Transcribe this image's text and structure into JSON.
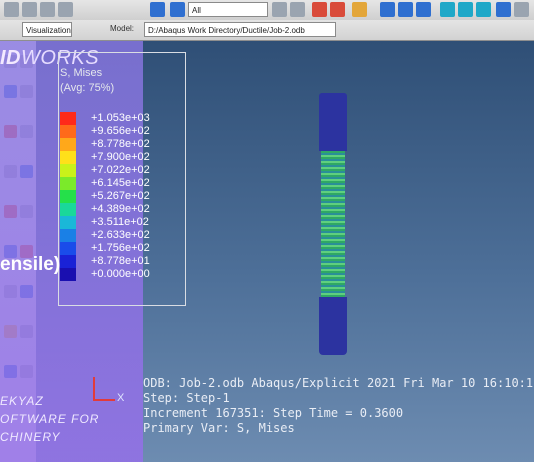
{
  "toolbar": {
    "render_style_label": "Visualization",
    "all_select": "All",
    "model_label": "Model:",
    "model_path": "D:/Abaqus Work Directory/Ductile/Job-2.odb"
  },
  "overlay": {
    "brand_bold": "ID",
    "brand_light": "WORKS",
    "title_fragment": "ensile)",
    "footer_lines": [
      "EKYAZ",
      "OFTWARE FOR",
      "CHINERY"
    ]
  },
  "legend": {
    "title": "S, Mises",
    "average": "(Avg: 75%)",
    "values": [
      "+1.053e+03",
      "+9.656e+02",
      "+8.778e+02",
      "+7.900e+02",
      "+7.022e+02",
      "+6.145e+02",
      "+5.267e+02",
      "+4.389e+02",
      "+3.511e+02",
      "+2.633e+02",
      "+1.756e+02",
      "+8.778e+01",
      "+0.000e+00"
    ],
    "colors": [
      "#ff2a1a",
      "#ff6a1a",
      "#ffa81a",
      "#ffe01a",
      "#c9f21a",
      "#7bea2a",
      "#25e04a",
      "#1ad89a",
      "#1ab8d8",
      "#1a80e6",
      "#1a4cea",
      "#1a22d6",
      "#1a0fb0"
    ]
  },
  "triad": {
    "x_label": "X"
  },
  "info": {
    "odb_line": "ODB: Job-2.odb    Abaqus/Explicit 2021    Fri Mar 10 16:10:1",
    "step_line": "Step: Step-1",
    "increment_line": "Increment    167351: Step Time =    0.3600",
    "primary_var_line": "Primary Var: S, Mises"
  },
  "colors": {
    "overlay": "#8c78e6",
    "specimen_end": "#2c33a0",
    "specimen_gauge": "#4fc37a"
  }
}
